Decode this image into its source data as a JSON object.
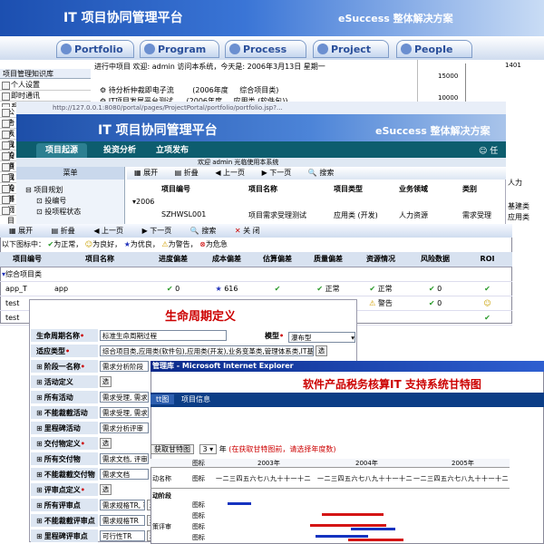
{
  "banner": {
    "title": "IT 项目协同管理平台",
    "slogan": "eSuccess 整体解决方案"
  },
  "nav_tabs": [
    "Portfolio",
    "Program",
    "Process",
    "Project",
    "PeopIe"
  ],
  "w1": {
    "status": "进行中项目 欢迎: admin 访问本系统，今天是: 2006年3月13日 星期一",
    "sidebar_title": "项目管理知识库",
    "sidebar_items": [
      "个人设置",
      "即时通讯",
      "系统",
      "公告",
      "个人",
      "项目",
      "我的",
      "投资",
      "项目",
      "我的",
      "投资",
      "部门",
      "项目",
      "项目",
      "项目"
    ],
    "rows": [
      {
        "name": "待分析仲裁即电子流",
        "year": "(2006年度",
        "type": "综合项目类)"
      },
      {
        "name": "IT项目发展平台测试",
        "year": "(2006年度",
        "type": "应用类 (软件包))"
      }
    ],
    "chart_ticks": [
      "1401",
      "15000",
      "10000"
    ]
  },
  "w2": {
    "address": "http://127.0.0.1:8080/portal/pages/ProjectPortal/portfolio/portfolio.jsp?...",
    "banner_title": "IT 项目协同管理平台",
    "slogan": "eSuccess 整体解决方案",
    "tabs": [
      "项目起源",
      "投资分析",
      "立项发布"
    ],
    "user_label": "任",
    "status": "欢迎 admin 光临使用本系统",
    "menu_title": "菜单",
    "menu_items": [
      "项目规划",
      "投编号",
      "投项程状态"
    ],
    "tools": [
      "展开",
      "折叠",
      "上一页",
      "下一页",
      "搜索"
    ],
    "table_headers": [
      "项目编号",
      "项目名称",
      "项目类型",
      "业务领域",
      "类别"
    ],
    "year": "2006",
    "row": [
      "SZHWSL001",
      "项目需求受理测试",
      "应用类 (开发)",
      "人力资源",
      "需求受理"
    ],
    "right_text": [
      "人力",
      "基建类",
      "应用类"
    ]
  },
  "w3": {
    "tools": [
      "展开",
      "折叠",
      "上一页",
      "下一页",
      "搜索",
      "关 闭"
    ],
    "legend": "以下图标中：正常 为正常， 为良好， 为优良， 为警告， 为危急",
    "legend_items": [
      {
        "icon": "ok-icon",
        "text": "为正常，"
      },
      {
        "icon": "smile-icon",
        "text": "为良好，"
      },
      {
        "icon": "star-icon",
        "text": "为优良，"
      },
      {
        "icon": "warn-icon",
        "text": "为警告，"
      },
      {
        "icon": "danger-icon",
        "text": "为危急"
      }
    ],
    "legend_prefix": "以下图标中：",
    "headers": [
      "项目编号",
      "项目名称",
      "进度偏差",
      "成本偏差",
      "估算偏差",
      "质量偏差",
      "资源情况",
      "风险数据",
      "ROI"
    ],
    "group_label": "综合项目类",
    "rows": [
      {
        "code": "app_T",
        "name": "app",
        "progress": "0",
        "cost": "616",
        "quality": "正常",
        "resource": "正常",
        "risk": "0"
      },
      {
        "code": "test",
        "name": "",
        "progress": "",
        "cost": "",
        "quality": "",
        "resource": "警告",
        "risk": "0"
      },
      {
        "code": "test",
        "name": "",
        "progress": "",
        "cost": "",
        "quality": "",
        "resource": "",
        "risk": ""
      }
    ]
  },
  "w4": {
    "title": "生命周期定义",
    "fields": [
      {
        "label": "生命周期名称",
        "required": true,
        "value": "标准生命周期过程",
        "expand": false
      },
      {
        "label": "适应类型",
        "required": true,
        "value": "综合项目类,应用类(软件包),应用类(开发),业务变革类,管理体系类,IT基建类",
        "expand": false
      },
      {
        "label": "阶段一名称",
        "required": true,
        "value": "需求分析阶段",
        "expand": true
      },
      {
        "label": "活动定义",
        "required": false,
        "value": "选",
        "expand": true
      },
      {
        "label": "所有活动",
        "required": false,
        "value": "需求受理, 需求分",
        "expand": true
      },
      {
        "label": "不能裁截活动",
        "required": false,
        "value": "需求受理, 需求分",
        "expand": true
      },
      {
        "label": "里程碑活动",
        "required": false,
        "value": "需求分析评审",
        "expand": true
      },
      {
        "label": "交付物定义",
        "required": true,
        "value": "选",
        "expand": true
      },
      {
        "label": "所有交付物",
        "required": false,
        "value": "需求文档, 评审报",
        "expand": true
      },
      {
        "label": "不能裁截交付物",
        "required": false,
        "value": "需求文档",
        "expand": true
      },
      {
        "label": "评审点定义",
        "required": true,
        "value": "选",
        "expand": true
      },
      {
        "label": "所有评审点",
        "required": false,
        "value": "需求规格TR, 可行性分析",
        "expand": true
      },
      {
        "label": "不能裁截评审点",
        "required": false,
        "value": "需求规格TR",
        "expand": true
      },
      {
        "label": "里程碑评审点",
        "required": false,
        "value": "可行性TR",
        "expand": true
      }
    ],
    "model_label": "模型",
    "model_value": "瀑布型",
    "select_btn": "选"
  },
  "w5": {
    "window_title": "管理库 - Microsoft Internet Explorer",
    "title": "软件产品税务核算IT 支持系统甘特图",
    "tabs": [
      "tt图",
      "项目信息"
    ],
    "ctrl_btn": "获取甘特图",
    "ctrl_select": "3",
    "ctrl_unit": "年",
    "ctrl_note": "(在获取甘特图前，请选择年度数)",
    "years": [
      "2003年",
      "2004年",
      "2005年"
    ],
    "months": "一二三四五六七八九十十一十二",
    "col_label": "图标",
    "row_label": "动名称",
    "activity_label": "动阶段",
    "rows": [
      {
        "label": "图标",
        "extra": "",
        "bars": [
          {
            "color": "#1533c0",
            "start": 0.04,
            "end": 0.12
          }
        ]
      },
      {
        "label": "图标",
        "extra": "",
        "bars": [
          {
            "color": "#d41515",
            "start": 0.36,
            "end": 0.57
          }
        ]
      },
      {
        "label": "图标",
        "extra": "策评审",
        "bars": [
          {
            "color": "#d41515",
            "start": 0.32,
            "end": 0.58
          },
          {
            "color": "#1533c0",
            "start": 0.46,
            "end": 0.61
          }
        ]
      },
      {
        "label": "图标",
        "extra": "",
        "bars": [
          {
            "color": "#1533c0",
            "start": 0.34,
            "end": 0.52
          },
          {
            "color": "#d41515",
            "start": 0.45,
            "end": 0.64
          }
        ]
      }
    ]
  }
}
